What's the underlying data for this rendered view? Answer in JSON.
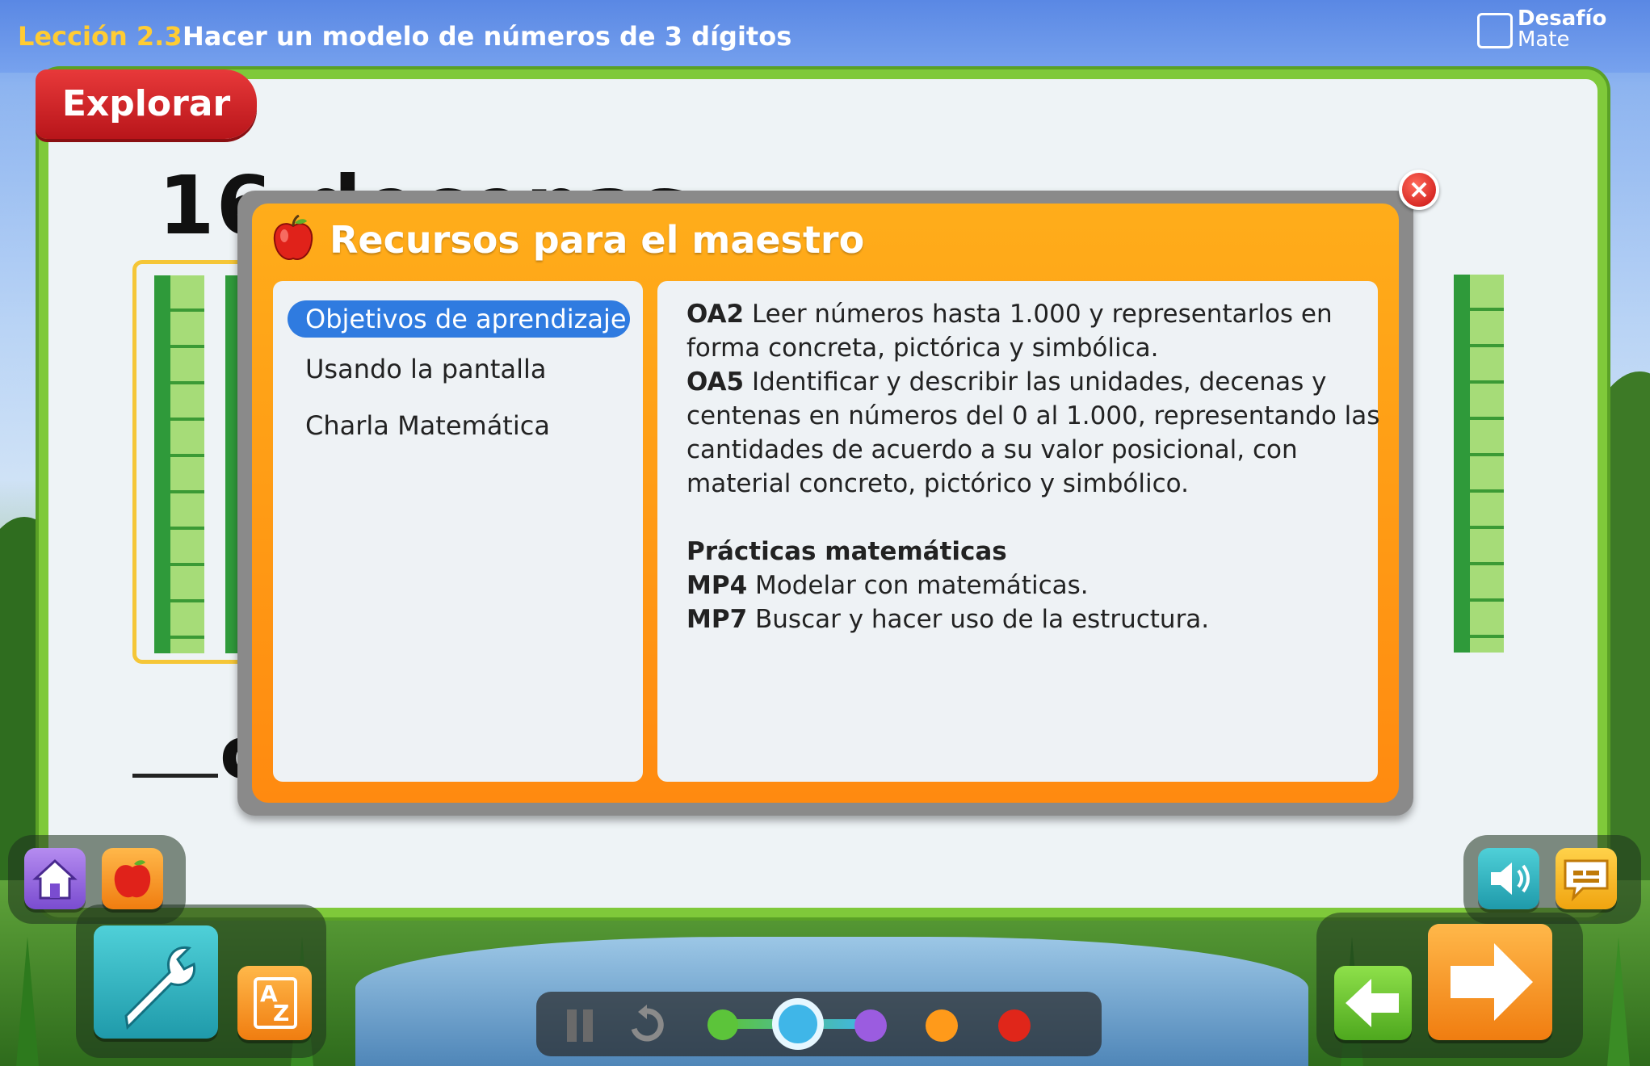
{
  "header": {
    "lesson_number": "Lección 2.3",
    "lesson_title": "Hacer un modelo de números de 3 dígitos",
    "brand_line1": "Desafío",
    "brand_line2": "Mate"
  },
  "board": {
    "section_label": "Explorar",
    "big_label": "16 decenas",
    "blank_letter": "c"
  },
  "modal": {
    "title": "Recursos para el maestro",
    "close_icon": "×",
    "menu": [
      {
        "label": "Objetivos de aprendizaje",
        "active": true
      },
      {
        "label": "Usando la pantalla",
        "active": false
      },
      {
        "label": "Charla Matemática",
        "active": false
      }
    ],
    "content": {
      "oa2_code": "OA2",
      "oa2_line1": "Leer números hasta 1.000 y representarlos en",
      "oa2_line2": "forma concreta, pictórica y simbólica.",
      "oa5_code": "OA5",
      "oa5_line1": "Identificar y describir las unidades, decenas y",
      "oa5_line2": "centenas en números del 0 al 1.000, representando las",
      "oa5_line3": "cantidades de acuerdo a su valor posicional, con",
      "oa5_line4": "material concreto, pictórico y simbólico.",
      "practices_heading": "Prácticas matemáticas",
      "mp4_code": "MP4",
      "mp4_text": "Modelar con matemáticas.",
      "mp7_code": "MP7",
      "mp7_text": "Buscar y hacer uso de la estructura."
    }
  },
  "controls": {
    "home_icon": "home-icon",
    "teacher_icon": "apple-icon",
    "tools_icon": "wrench-icon",
    "glossary_label_a": "A",
    "glossary_label_z": "Z",
    "audio_icon": "speaker-icon",
    "caption_icon": "caption-icon",
    "back_icon": "arrow-left-icon",
    "next_icon": "arrow-right-icon",
    "pause_icon": "pause-icon",
    "replay_icon": "replay-icon",
    "progress_dots": [
      "#5cc43a",
      "#3fb6e8",
      "#9b5ce0",
      "#ff9a1a",
      "#e0261a"
    ]
  },
  "colors": {
    "accent_orange": "#ff8a10",
    "board_green": "#7fc93a",
    "active_blue": "#2f7be0",
    "header_blue": "#5a88e4",
    "lesson_yellow": "#ffcc33"
  }
}
